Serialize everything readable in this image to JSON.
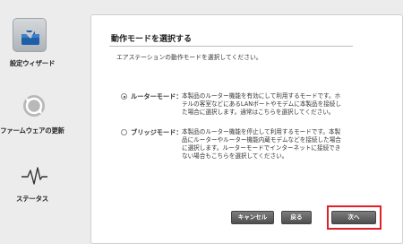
{
  "sidebar": {
    "items": [
      {
        "label": "設定ウィザード",
        "icon": "toolbox-icon",
        "active": true
      },
      {
        "label": "ファームウェアの更新",
        "icon": "refresh-icon",
        "active": false
      },
      {
        "label": "ステータス",
        "icon": "pulse-icon",
        "active": false
      }
    ]
  },
  "panel": {
    "title": "動作モードを選択する",
    "instruction": "エアステーションの動作モードを選択してください。",
    "modes": [
      {
        "label": "ルーターモード：",
        "selected": true,
        "description": "本製品のルーター機能を有効にして利用するモードです。ホテルの客室などにあるLANポートやモデムに本製品を接続した場合に選択します。通常はこちらを選択してください。"
      },
      {
        "label": "ブリッジモード：",
        "selected": false,
        "description": "本製品のルーター機能を停止して利用するモードです。本製品にルーターやルーター機能内蔵モデムなどを接続した場合に選択します。ルーターモードでインターネットに接続できない場合もこちらを選択してください。"
      }
    ],
    "buttons": {
      "cancel": "キャンセル",
      "back": "戻る",
      "next": "次へ"
    }
  },
  "colors": {
    "highlight": "#e0202a",
    "button": "#5e5e5e"
  }
}
